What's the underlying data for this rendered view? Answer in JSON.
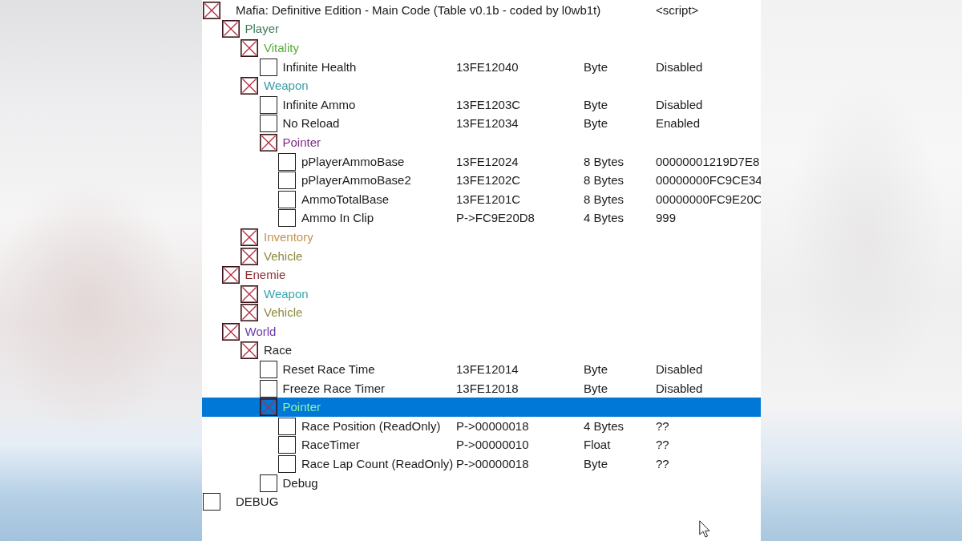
{
  "table": {
    "rows": [
      {
        "kind": "group",
        "description": "Mafia: Definitive Edition - Main Code (Table v0.1b - coded by l0wb1t)",
        "value": "<script>",
        "selected": false,
        "children": [
          {
            "kind": "group",
            "description": "Player",
            "color": "#3b7d5c",
            "selected": false,
            "children": [
              {
                "kind": "group",
                "description": "Vitality",
                "color": "#55ab3c",
                "selected": false,
                "children": [
                  {
                    "kind": "entry",
                    "checked": false,
                    "description": "Infinite Health",
                    "address": "13FE12040",
                    "type": "Byte",
                    "value": "Disabled",
                    "selected": false
                  }
                ]
              },
              {
                "kind": "group",
                "description": "Weapon",
                "color": "#3a9ca3",
                "selected": false,
                "children": [
                  {
                    "kind": "entry",
                    "checked": false,
                    "description": "Infinite Ammo",
                    "address": "13FE1203C",
                    "type": "Byte",
                    "value": "Disabled",
                    "selected": false
                  },
                  {
                    "kind": "entry",
                    "checked": false,
                    "description": "No Reload",
                    "address": "13FE12034",
                    "type": "Byte",
                    "value": "Enabled",
                    "selected": false
                  },
                  {
                    "kind": "group",
                    "description": "Pointer",
                    "color": "#7d2b86",
                    "selected": false,
                    "children": [
                      {
                        "kind": "entry",
                        "checked": false,
                        "description": "pPlayerAmmoBase",
                        "address": "13FE12024",
                        "type": "8 Bytes",
                        "value": "00000001219D7E8",
                        "selected": false
                      },
                      {
                        "kind": "entry",
                        "checked": false,
                        "description": "pPlayerAmmoBase2",
                        "address": "13FE1202C",
                        "type": "8 Bytes",
                        "value": "00000000FC9CE34",
                        "selected": false
                      },
                      {
                        "kind": "entry",
                        "checked": false,
                        "description": "AmmoTotalBase",
                        "address": "13FE1201C",
                        "type": "8 Bytes",
                        "value": "00000000FC9E20C",
                        "selected": false
                      },
                      {
                        "kind": "entry",
                        "checked": false,
                        "description": "Ammo In Clip",
                        "address": "P->FC9E20D8",
                        "type": "4 Bytes",
                        "value": "999",
                        "selected": false
                      }
                    ]
                  }
                ]
              },
              {
                "kind": "group",
                "description": "Inventory",
                "color": "#c4904e",
                "selected": false
              },
              {
                "kind": "group",
                "description": "Vehicle",
                "color": "#8a8a3e",
                "selected": false
              }
            ]
          },
          {
            "kind": "group",
            "description": "Enemie",
            "color": "#8a2f33",
            "selected": false,
            "children": [
              {
                "kind": "group",
                "description": "Weapon",
                "color": "#3aa5ad",
                "selected": false
              },
              {
                "kind": "group",
                "description": "Vehicle",
                "color": "#8a8a3e",
                "selected": false
              }
            ]
          },
          {
            "kind": "group",
            "description": "World",
            "color": "#6a3aa6",
            "selected": false,
            "children": [
              {
                "kind": "group",
                "description": "Race",
                "selected": false,
                "children": [
                  {
                    "kind": "entry",
                    "checked": false,
                    "description": "Reset Race Time",
                    "address": "13FE12014",
                    "type": "Byte",
                    "value": "Disabled",
                    "selected": false
                  },
                  {
                    "kind": "entry",
                    "checked": false,
                    "description": "Freeze Race Timer",
                    "address": "13FE12018",
                    "type": "Byte",
                    "value": "Disabled",
                    "selected": false
                  },
                  {
                    "kind": "group",
                    "description": "Pointer",
                    "color": "#8ef0a6",
                    "selected": true,
                    "children": [
                      {
                        "kind": "entry",
                        "checked": false,
                        "description": "Race Position (ReadOnly)",
                        "address": "P->00000018",
                        "type": "4 Bytes",
                        "value": "??",
                        "selected": false
                      },
                      {
                        "kind": "entry",
                        "checked": false,
                        "description": "RaceTimer",
                        "address": "P->00000010",
                        "type": "Float",
                        "value": "??",
                        "selected": false
                      },
                      {
                        "kind": "entry",
                        "checked": false,
                        "description": "Race Lap Count (ReadOnly)",
                        "address": "P->00000018",
                        "type": "Byte",
                        "value": "??",
                        "selected": false
                      }
                    ]
                  },
                  {
                    "kind": "entry",
                    "checked": false,
                    "description": "Debug",
                    "selected": false
                  }
                ]
              }
            ]
          }
        ]
      },
      {
        "kind": "entry",
        "checked": false,
        "description": "DEBUG",
        "selected": false
      }
    ]
  }
}
